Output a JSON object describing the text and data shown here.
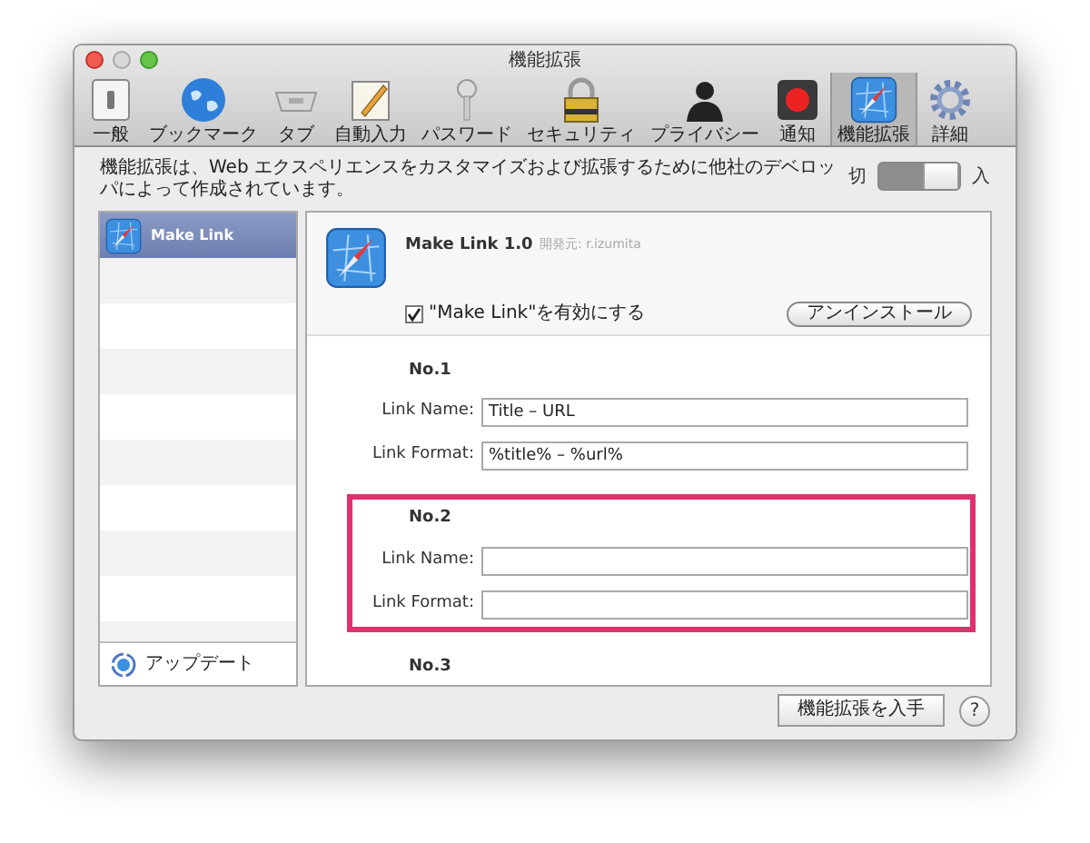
{
  "window": {
    "title": "機能拡張"
  },
  "toolbar": [
    {
      "label": "一般",
      "kind": "switch",
      "selected": false
    },
    {
      "label": "ブックマーク",
      "kind": "globe",
      "selected": false
    },
    {
      "label": "タブ",
      "kind": "tab",
      "selected": false
    },
    {
      "label": "自動入力",
      "kind": "pencil",
      "selected": false
    },
    {
      "label": "パスワード",
      "kind": "key",
      "selected": false
    },
    {
      "label": "セキュリティ",
      "kind": "lock",
      "selected": false
    },
    {
      "label": "プライバシー",
      "kind": "person",
      "selected": false
    },
    {
      "label": "通知",
      "kind": "record",
      "selected": false
    },
    {
      "label": "機能拡張",
      "kind": "compass",
      "selected": true
    },
    {
      "label": "詳細",
      "kind": "gear",
      "selected": false
    }
  ],
  "description": "機能拡張は、Web エクスペリエンスをカスタマイズおよび拡張するために他社のデベロッパによって作成されています。",
  "toggle": {
    "off_label": "切",
    "on_label": "入",
    "on": true
  },
  "sidebar": {
    "items": [
      {
        "label": "Make Link",
        "selected": true
      }
    ],
    "update_label": "アップデート"
  },
  "extension": {
    "name": "Make Link 1.0",
    "developer": "開発元: r.izumita",
    "enable_label": "\"Make Link\"を有効にする",
    "enabled": true,
    "uninstall_button": "アンインストール"
  },
  "settings": [
    {
      "heading": "No.1",
      "highlighted": false,
      "fields": [
        {
          "label": "Link Name:",
          "value": "Title – URL"
        },
        {
          "label": "Link Format:",
          "value": "%title% – %url%"
        }
      ]
    },
    {
      "heading": "No.2",
      "highlighted": true,
      "fields": [
        {
          "label": "Link Name:"
        },
        {
          "label": "Link Format:"
        }
      ]
    },
    {
      "heading": "No.3",
      "highlighted": false
    }
  ],
  "footer": {
    "get_button": "機能拡張を入手",
    "help_button": "?"
  }
}
